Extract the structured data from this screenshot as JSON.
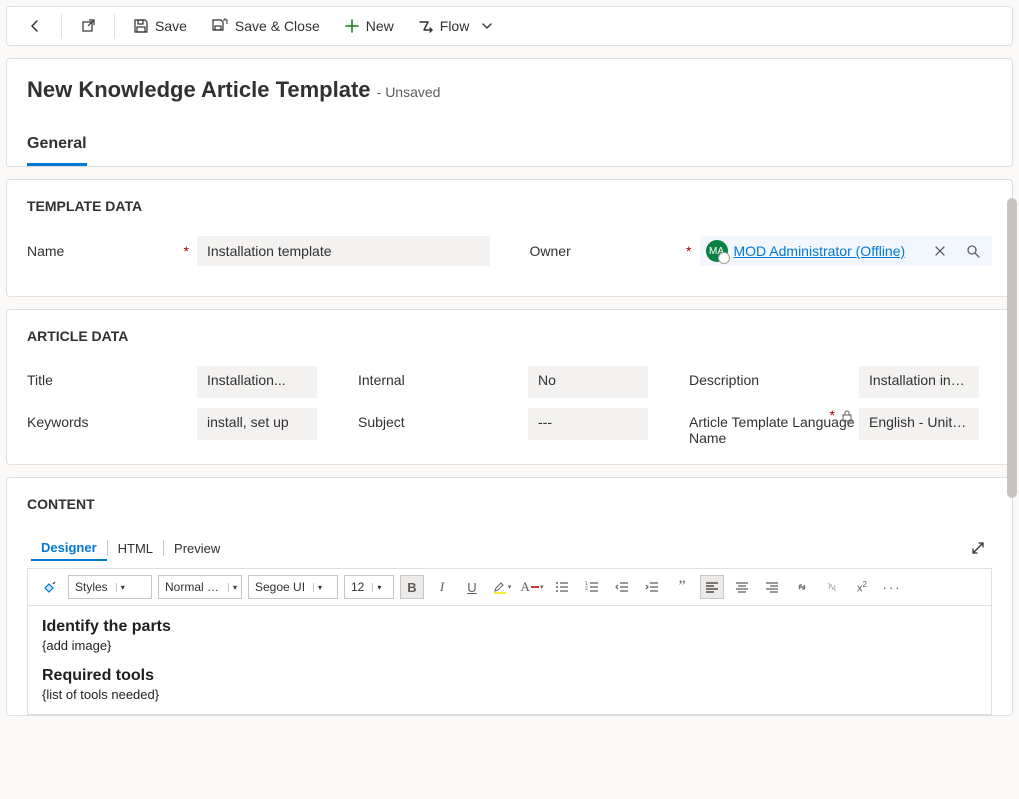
{
  "toolbar": {
    "save": "Save",
    "save_close": "Save & Close",
    "new": "New",
    "flow": "Flow"
  },
  "header": {
    "title": "New Knowledge Article Template",
    "status": "- Unsaved",
    "tabs": [
      {
        "label": "General"
      }
    ]
  },
  "template_data": {
    "section_title": "TEMPLATE DATA",
    "name_label": "Name",
    "name_value": "Installation template",
    "owner_label": "Owner",
    "owner_value": "MOD Administrator (Offline)",
    "owner_avatar_initials": "MA"
  },
  "article_data": {
    "section_title": "ARTICLE DATA",
    "fields": {
      "title_label": "Title",
      "title_value": "Installation...",
      "internal_label": "Internal",
      "internal_value": "No",
      "description_label": "Description",
      "description_value": "Installation ins...",
      "keywords_label": "Keywords",
      "keywords_value": "install, set up",
      "subject_label": "Subject",
      "subject_value": "---",
      "lang_label": "Article Template Language Name",
      "lang_value": "English - Unite..."
    }
  },
  "content": {
    "section_title": "CONTENT",
    "subtabs": [
      {
        "label": "Designer",
        "active": true
      },
      {
        "label": "HTML",
        "active": false
      },
      {
        "label": "Preview",
        "active": false
      }
    ],
    "toolbar": {
      "styles": "Styles",
      "format": "Normal (...",
      "font": "Segoe UI",
      "size": "12"
    },
    "body": {
      "h1": "Identify the parts",
      "p1": "{add image}",
      "h2": "Required tools",
      "p2": "{list of tools needed}"
    }
  }
}
